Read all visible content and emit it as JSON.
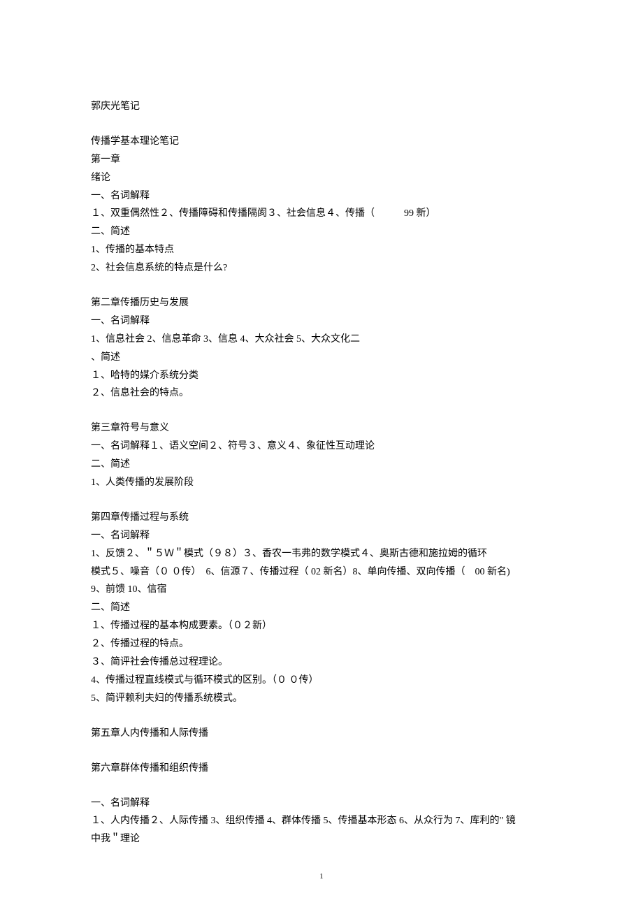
{
  "title": "郭庆光笔记",
  "intro": [
    "传播学基本理论笔记",
    "第一章",
    "绪论",
    "一、名词解释",
    "１、双重偶然性２、传播障碍和传播隔阂３、社会信息４、传播（　　　99 新）",
    "二、简述",
    "1、传播的基本特点",
    "2、社会信息系统的特点是什么?"
  ],
  "ch2": [
    "第二章传播历史与发展",
    "一、名词解释",
    "1、信息社会 2、信息革命 3、信息 4、大众社会 5、大众文化二",
    "、简述",
    "１、哈特的媒介系统分类",
    "２、信息社会的特点。"
  ],
  "ch3": [
    "第三章符号与意义",
    "一、名词解释１、语义空间２、符号３、意义４、象征性互动理论",
    "二、简述",
    "1、人类传播的发展阶段"
  ],
  "ch4": [
    "第四章传播过程与系统",
    "一、名词解释",
    "1、反馈２、＂５Ｗ＂模式（９８）３、香农一韦弗的数学模式４、奥斯古德和施拉姆的循环",
    "模式５、噪音（０ ０传）　6、信源７、传播过程（ 02 新名）8、单向传播、双向传播（　00 新名)",
    "9、前馈 10、信宿",
    "二、简述",
    "１、传播过程的基本构成要素。（０２新）",
    "２、传播过程的特点。",
    "３、简评社会传播总过程理论。",
    "4、传播过程直线模式与循环模式的区别。（０ ０传）",
    "5、简评赖利夫妇的传播系统模式。"
  ],
  "ch5": [
    "第五章人内传播和人际传播"
  ],
  "ch6": [
    "第六章群体传播和组织传播"
  ],
  "ch6b": [
    "一、名词解释",
    "１、人内传播２、人际传播 3、组织传播 4、群体传播 5、传播基本形态 6、从众行为 7、库利的\" 镜",
    "中我＂理论"
  ],
  "page_num": "1"
}
